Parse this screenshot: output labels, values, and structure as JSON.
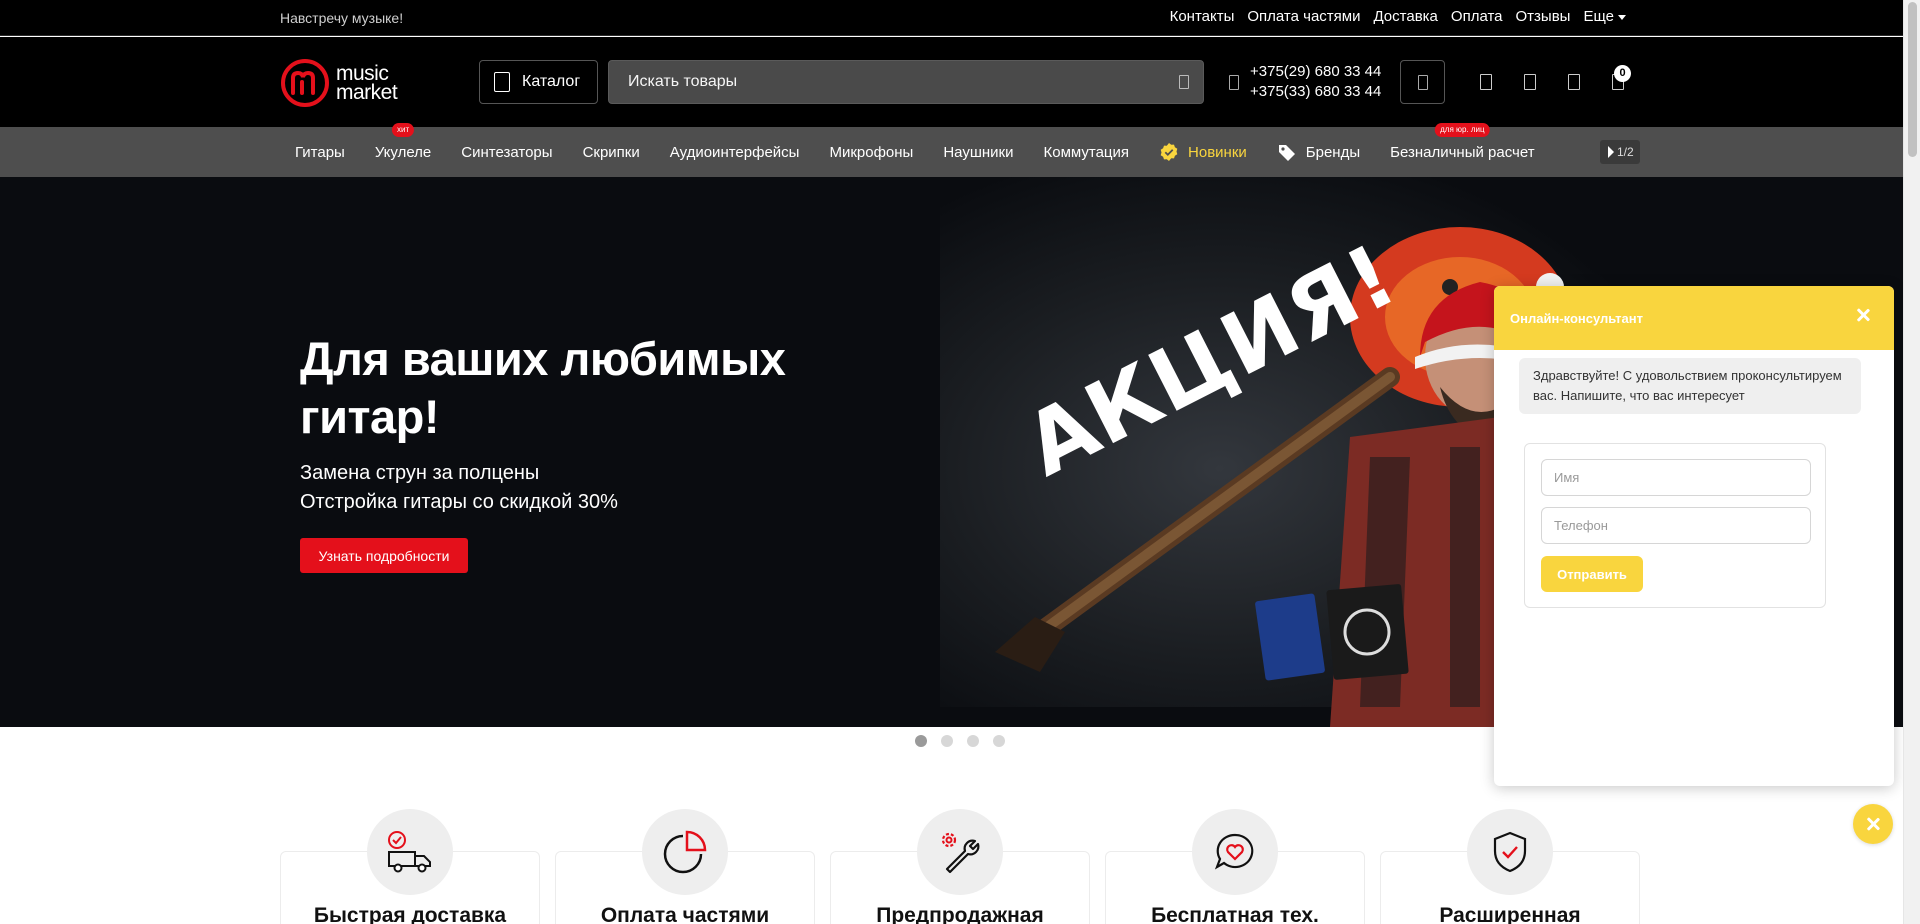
{
  "topbar": {
    "tagline": "Навстречу музыке!",
    "links": [
      "Контакты",
      "Оплата частями",
      "Доставка",
      "Оплата",
      "Отзывы",
      "Еще"
    ]
  },
  "header": {
    "logo_line1": "music",
    "logo_line2": "market",
    "catalog_label": "Каталог",
    "search_placeholder": "Искать товары",
    "phone1": "+375(29) 680 33 44",
    "phone2": "+375(33) 680 33 44",
    "cart_count": "0",
    "icons": [
      "compare-icon",
      "favorites-icon",
      "user-icon",
      "cart-icon"
    ]
  },
  "nav": {
    "items": [
      {
        "label": "Гитары",
        "badge": ""
      },
      {
        "label": "Укулеле",
        "badge": "хит"
      },
      {
        "label": "Синтезаторы",
        "badge": ""
      },
      {
        "label": "Скрипки",
        "badge": ""
      },
      {
        "label": "Аудиоинтерфейсы",
        "badge": ""
      },
      {
        "label": "Микрофоны",
        "badge": ""
      },
      {
        "label": "Наушники",
        "badge": ""
      },
      {
        "label": "Коммутация",
        "badge": ""
      },
      {
        "label": "Новинки",
        "badge": ""
      },
      {
        "label": "Бренды",
        "badge": ""
      },
      {
        "label": "Безналичный расчет",
        "badge": "для юр. лиц"
      }
    ],
    "pager": "1/2"
  },
  "hero": {
    "title_line1": "Для ваших любимых",
    "title_line2": "гитар!",
    "sub_line1": "Замена струн за полцены",
    "sub_line2": "Отстройка гитары со скидкой 30%",
    "button": "Узнать подробности",
    "promo_text": "АКЦИЯ!",
    "slides": 4,
    "active_slide": 1
  },
  "features": [
    {
      "title": "Быстрая доставка",
      "icon": "delivery-truck-icon"
    },
    {
      "title": "Оплата частями",
      "icon": "pie-chart-icon"
    },
    {
      "title": "Предпродажная",
      "icon": "wrench-gear-icon"
    },
    {
      "title": "Бесплатная тех.",
      "icon": "chat-heart-icon"
    },
    {
      "title": "Расширенная",
      "icon": "shield-check-icon"
    }
  ],
  "chat": {
    "title": "Онлайн-консультант",
    "message": "Здравствуйте! С удовольствием проконсультируем вас. Напишите, что вас интересует",
    "name_placeholder": "Имя",
    "phone_placeholder": "Телефон",
    "send_label": "Отправить"
  },
  "colors": {
    "brand_red": "#e4101b",
    "accent_yellow": "#f9d53e",
    "nav_bg": "#4e4e4e"
  }
}
